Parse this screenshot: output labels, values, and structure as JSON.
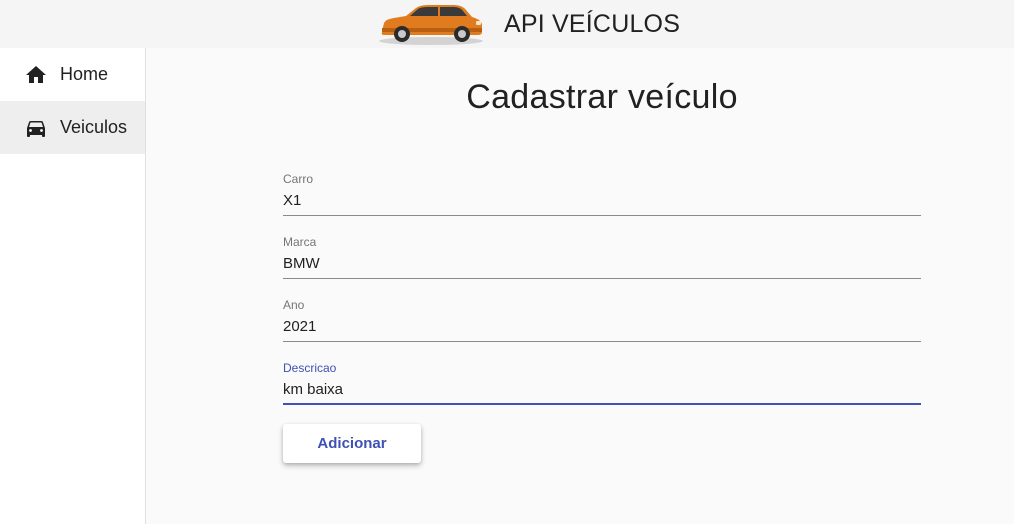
{
  "header": {
    "title": "API VEÍCULOS",
    "logo_icon": "orange-suv-car-icon"
  },
  "sidebar": {
    "items": [
      {
        "label": "Home",
        "icon": "home-icon",
        "active": false
      },
      {
        "label": "Veiculos",
        "icon": "car-icon",
        "active": true
      }
    ]
  },
  "main": {
    "title": "Cadastrar veículo",
    "form": {
      "fields": [
        {
          "label": "Carro",
          "value": "X1",
          "focused": false
        },
        {
          "label": "Marca",
          "value": "BMW",
          "focused": false
        },
        {
          "label": "Ano",
          "value": "2021",
          "focused": false
        },
        {
          "label": "Descricao",
          "value": "km baixa",
          "focused": true
        }
      ],
      "submit_label": "Adicionar"
    }
  },
  "colors": {
    "primary": "#3f51b5",
    "car_body": "#e07b1f",
    "header_bg": "#f5f5f5",
    "active_nav_bg": "#eeeeee"
  }
}
